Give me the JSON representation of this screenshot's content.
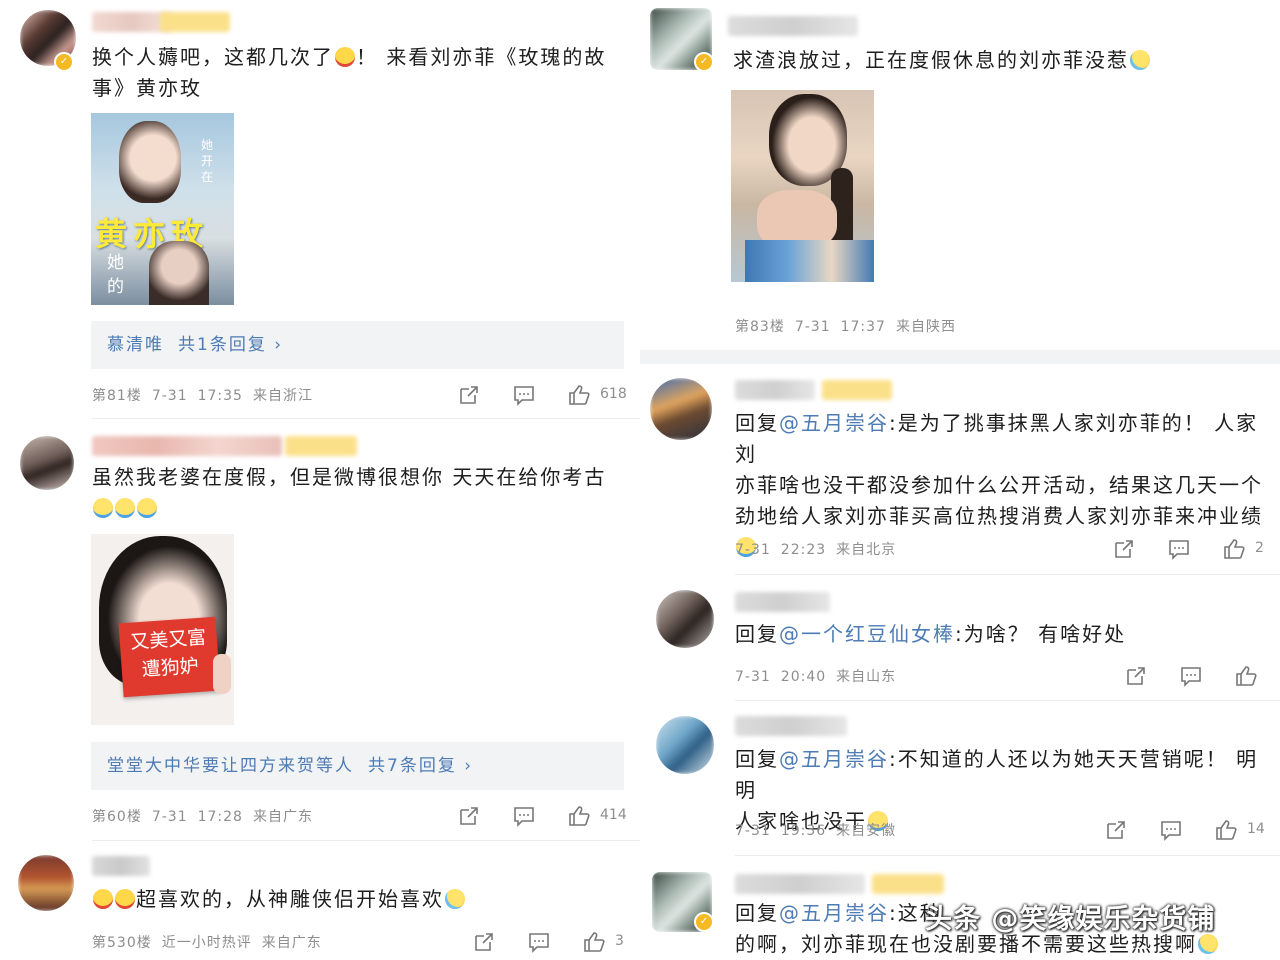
{
  "left_column": {
    "comments": [
      {
        "text_line1": "换个人薅吧，这都几次了",
        "text_line1_tail": "！ 来看刘亦菲《玫瑰的故",
        "text_line2": "事》黄亦玫",
        "poster": {
          "vertical_text": "她开在",
          "big_text": "黄亦玫",
          "side_text": "她的"
        },
        "replies": {
          "name": "慕清唯",
          "count_text": "共1条回复",
          "chevron": "›"
        },
        "meta": {
          "floor": "第81楼",
          "date": "7-31",
          "time": "17:35",
          "location": "来自浙江"
        },
        "likes": "618"
      },
      {
        "text_line1": "虽然我老婆在度假，但是微博很想你 天天在给你考古",
        "photo_sign": {
          "line1": "又美又富",
          "line2": "遭狗妒"
        },
        "replies": {
          "name": "堂堂大中华要让四方来贺等人",
          "count_text": "共7条回复",
          "chevron": "›"
        },
        "meta": {
          "floor": "第60楼",
          "date": "7-31",
          "time": "17:28",
          "location": "来自广东"
        },
        "likes": "414"
      },
      {
        "text_line1": "超喜欢的，从神雕侠侣开始喜欢",
        "meta": {
          "floor": "第530楼",
          "date": "近一小时热评",
          "location": "来自广东"
        },
        "likes": "3"
      }
    ]
  },
  "right_column": {
    "top_comment": {
      "text_line1": "求渣浪放过，正在度假休息的刘亦菲没惹",
      "meta": {
        "floor": "第83楼",
        "date": "7-31",
        "time": "17:37",
        "location": "来自陕西"
      }
    },
    "replies": [
      {
        "prefix": "回复",
        "mention": "@五月崇谷",
        "line1": ":是为了挑事抹黑人家刘亦菲的！ 人家刘",
        "line2": "亦菲啥也没干都没参加什么公开活动，结果这几天一个",
        "line3": "劲地给人家刘亦菲买高位热搜消费人家刘亦菲来冲业绩",
        "meta": {
          "date": "7-31",
          "time": "22:23",
          "location": "来自北京"
        },
        "likes": "2"
      },
      {
        "prefix": "回复",
        "mention": "@一个红豆仙女棒",
        "line1": ":为啥？ 有啥好处",
        "meta": {
          "date": "7-31",
          "time": "20:40",
          "location": "来自山东"
        },
        "likes": ""
      },
      {
        "prefix": "回复",
        "mention": "@五月崇谷",
        "line1": ":不知道的人还以为她天天营销呢！ 明明",
        "line2": "人家啥也没干",
        "meta": {
          "date": "7-31",
          "time": "19:36",
          "location": "来自安徽"
        },
        "likes": "14"
      },
      {
        "prefix": "回复",
        "mention": "@五月崇谷",
        "line1": ":这种",
        "line2": "的啊，刘亦菲现在也没剧要播不需要这些热搜啊"
      }
    ]
  },
  "watermark": "头条 @笑缘娱乐杂货铺",
  "icons": [
    "share-icon",
    "comment-icon",
    "like-icon",
    "verified-icon"
  ]
}
